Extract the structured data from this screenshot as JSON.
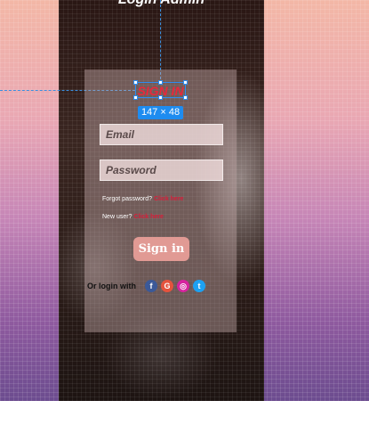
{
  "page": {
    "top_title": "Login Admin"
  },
  "login": {
    "heading": "SIGN IN",
    "selection_size": "147 × 48",
    "email_placeholder": "Email",
    "password_placeholder": "Password",
    "forgot_text": "Forgot password?",
    "forgot_link": "Click here",
    "new_user_text": "New user?",
    "new_user_link": "Click here",
    "signin_label": "Sign in",
    "social_label": "Or login with",
    "social": [
      {
        "name": "facebook",
        "glyph": "f",
        "color": "#3b5998"
      },
      {
        "name": "google",
        "glyph": "G",
        "color": "#e5533d"
      },
      {
        "name": "instagram",
        "glyph": "◎",
        "color": "#d6249f"
      },
      {
        "name": "twitter",
        "glyph": "t",
        "color": "#1da1f2"
      }
    ]
  }
}
